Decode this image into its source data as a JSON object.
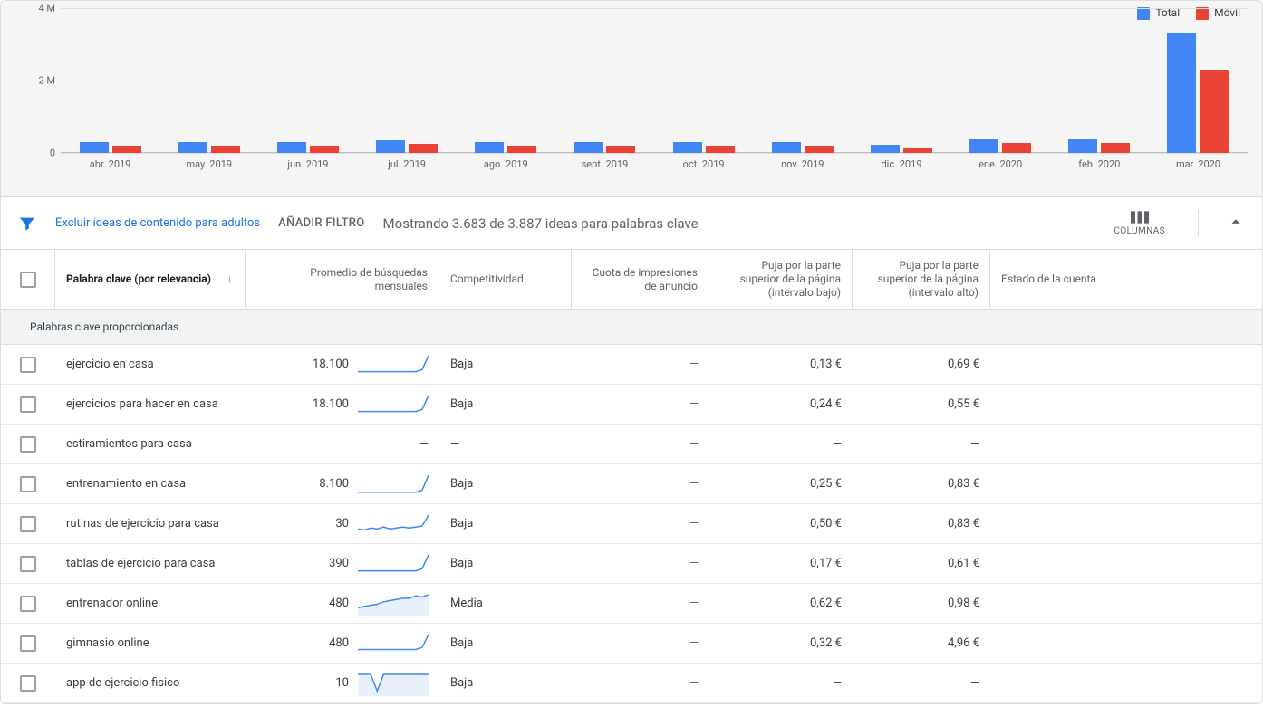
{
  "colors": {
    "total": "#4285f4",
    "movil": "#ea4335"
  },
  "legend": {
    "total": "Total",
    "movil": "Móvil"
  },
  "chart_data": {
    "type": "bar",
    "title": "",
    "xlabel": "",
    "ylabel": "",
    "ylim": [
      0,
      4000000
    ],
    "yticks": [
      {
        "v": 0,
        "label": "0"
      },
      {
        "v": 2000000,
        "label": "2 M"
      },
      {
        "v": 4000000,
        "label": "4 M"
      }
    ],
    "categories": [
      "abr. 2019",
      "may. 2019",
      "jun. 2019",
      "jul. 2019",
      "ago. 2019",
      "sept. 2019",
      "oct. 2019",
      "nov. 2019",
      "dic. 2019",
      "ene. 2020",
      "feb. 2020",
      "mar. 2020"
    ],
    "series": [
      {
        "name": "Total",
        "color": "#4285f4",
        "values": [
          300000,
          300000,
          300000,
          350000,
          300000,
          300000,
          300000,
          300000,
          220000,
          400000,
          400000,
          3300000
        ]
      },
      {
        "name": "Móvil",
        "color": "#ea4335",
        "values": [
          200000,
          200000,
          200000,
          250000,
          200000,
          200000,
          200000,
          200000,
          150000,
          280000,
          280000,
          2300000
        ]
      }
    ]
  },
  "filter_bar": {
    "exclude_adult": "Excluir ideas de contenido para adultos",
    "add_filter": "AÑADIR FILTRO",
    "showing": "Mostrando 3.683 de 3.887 ideas para palabras clave",
    "columns": "COLUMNAS"
  },
  "headers": {
    "keyword": "Palabra clave (por relevancia)",
    "avg": "Promedio de búsquedas mensuales",
    "comp": "Competitividad",
    "impr": "Cuota de impresiones de anuncio",
    "bid_low": "Puja por la parte superior de la página (intervalo bajo)",
    "bid_high": "Puja por la parte superior de la página (intervalo alto)",
    "status": "Estado de la cuenta"
  },
  "section_title": "Palabras clave proporcionadas",
  "rows": [
    {
      "kw": "ejercicio en casa",
      "avg": "18.100",
      "spark": [
        4,
        4,
        4,
        4,
        4,
        4,
        4,
        4,
        4,
        4,
        6,
        20
      ],
      "fill": false,
      "comp": "Baja",
      "impr": "—",
      "low": "0,13 €",
      "high": "0,69 €"
    },
    {
      "kw": "ejercicios para hacer en casa",
      "avg": "18.100",
      "spark": [
        4,
        4,
        4,
        4,
        4,
        4,
        4,
        4,
        4,
        4,
        6,
        20
      ],
      "fill": false,
      "comp": "Baja",
      "impr": "—",
      "low": "0,24 €",
      "high": "0,55 €"
    },
    {
      "kw": "estiramientos para casa",
      "avg": "—",
      "spark": null,
      "fill": false,
      "comp": "—",
      "impr": "—",
      "low": "—",
      "high": "—"
    },
    {
      "kw": "entrenamiento en casa",
      "avg": "8.100",
      "spark": [
        3,
        3,
        3,
        3,
        3,
        3,
        3,
        3,
        3,
        3,
        5,
        20
      ],
      "fill": false,
      "comp": "Baja",
      "impr": "—",
      "low": "0,25 €",
      "high": "0,83 €"
    },
    {
      "kw": "rutinas de ejercicio para casa",
      "avg": "30",
      "spark": [
        6,
        5,
        7,
        6,
        8,
        6,
        7,
        8,
        7,
        8,
        9,
        20
      ],
      "fill": false,
      "comp": "Baja",
      "impr": "—",
      "low": "0,50 €",
      "high": "0,83 €"
    },
    {
      "kw": "tablas de ejercicio para casa",
      "avg": "390",
      "spark": [
        4,
        4,
        4,
        4,
        4,
        4,
        4,
        4,
        4,
        4,
        6,
        20
      ],
      "fill": false,
      "comp": "Baja",
      "impr": "—",
      "low": "0,17 €",
      "high": "0,61 €"
    },
    {
      "kw": "entrenador online",
      "avg": "480",
      "spark": [
        6,
        7,
        8,
        9,
        11,
        12,
        13,
        14,
        14,
        16,
        15,
        17
      ],
      "fill": true,
      "comp": "Media",
      "impr": "—",
      "low": "0,62 €",
      "high": "0,98 €"
    },
    {
      "kw": "gimnasio online",
      "avg": "480",
      "spark": [
        5,
        5,
        5,
        5,
        5,
        5,
        5,
        5,
        5,
        5,
        7,
        20
      ],
      "fill": false,
      "comp": "Baja",
      "impr": "—",
      "low": "0,32 €",
      "high": "4,96 €"
    },
    {
      "kw": "app de ejercicio fisico",
      "avg": "10",
      "spark": [
        18,
        18,
        18,
        3,
        18,
        18,
        18,
        18,
        18,
        18,
        18,
        18
      ],
      "fill": true,
      "comp": "Baja",
      "impr": "—",
      "low": "—",
      "high": "—"
    }
  ]
}
